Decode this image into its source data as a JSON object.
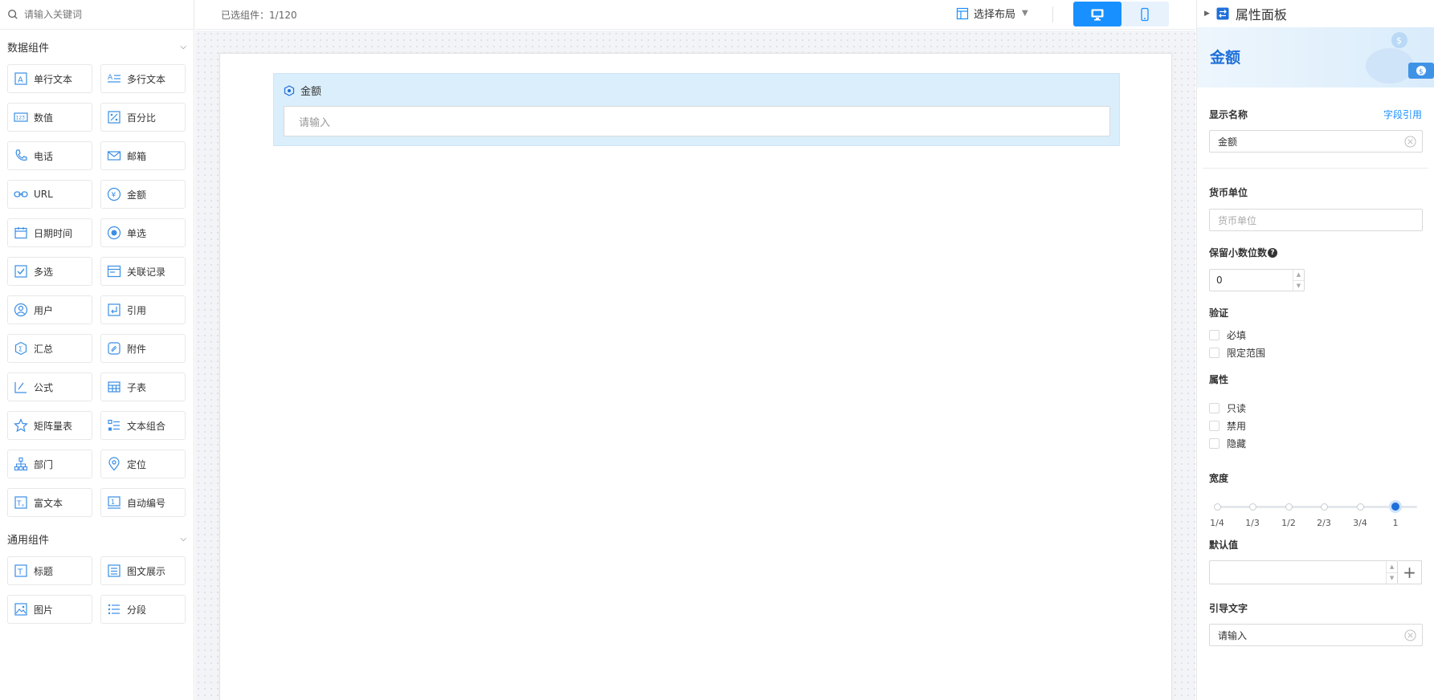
{
  "search": {
    "placeholder": "请输入关键词"
  },
  "data_group": {
    "title": "数据组件",
    "items": [
      {
        "label": "单行文本",
        "icon": "single-line-text-icon"
      },
      {
        "label": "多行文本",
        "icon": "multi-line-text-icon"
      },
      {
        "label": "数值",
        "icon": "number-icon"
      },
      {
        "label": "百分比",
        "icon": "percent-icon"
      },
      {
        "label": "电话",
        "icon": "phone-icon"
      },
      {
        "label": "邮箱",
        "icon": "mail-icon"
      },
      {
        "label": "URL",
        "icon": "link-icon"
      },
      {
        "label": "金额",
        "icon": "currency-icon"
      },
      {
        "label": "日期时间",
        "icon": "calendar-icon"
      },
      {
        "label": "单选",
        "icon": "radio-icon"
      },
      {
        "label": "多选",
        "icon": "checkbox-icon"
      },
      {
        "label": "关联记录",
        "icon": "related-record-icon"
      },
      {
        "label": "用户",
        "icon": "user-icon"
      },
      {
        "label": "引用",
        "icon": "reference-icon"
      },
      {
        "label": "汇总",
        "icon": "summary-icon"
      },
      {
        "label": "附件",
        "icon": "attachment-icon"
      },
      {
        "label": "公式",
        "icon": "formula-icon"
      },
      {
        "label": "子表",
        "icon": "subtable-icon"
      },
      {
        "label": "矩阵量表",
        "icon": "star-icon"
      },
      {
        "label": "文本组合",
        "icon": "text-combo-icon"
      },
      {
        "label": "部门",
        "icon": "department-icon"
      },
      {
        "label": "定位",
        "icon": "location-icon"
      },
      {
        "label": "富文本",
        "icon": "rich-text-icon"
      },
      {
        "label": "自动编号",
        "icon": "auto-number-icon"
      }
    ]
  },
  "general_group": {
    "title": "通用组件",
    "items": [
      {
        "label": "标题",
        "icon": "title-icon"
      },
      {
        "label": "图文展示",
        "icon": "image-text-icon"
      },
      {
        "label": "图片",
        "icon": "image-icon"
      },
      {
        "label": "分段",
        "icon": "section-icon"
      }
    ]
  },
  "topbar": {
    "selected_label": "已选组件：",
    "selected_count": "1/120",
    "layout_label": "选择布局"
  },
  "canvas": {
    "field_label": "金额",
    "field_placeholder": "请输入"
  },
  "panel": {
    "header": "属性面板",
    "banner_title": "金额",
    "display_name_label": "显示名称",
    "field_ref_link": "字段引用",
    "display_name_value": "金额",
    "currency_label": "货币单位",
    "currency_placeholder": "货币单位",
    "decimal_label": "保留小数位数",
    "decimal_value": "0",
    "validation_label": "验证",
    "required_label": "必填",
    "range_label": "限定范围",
    "attributes_label": "属性",
    "readonly_label": "只读",
    "disabled_label": "禁用",
    "hidden_label": "隐藏",
    "width_label": "宽度",
    "width_options": [
      "1/4",
      "1/3",
      "1/2",
      "2/3",
      "3/4",
      "1"
    ],
    "width_selected": "1",
    "default_label": "默认值",
    "guide_label": "引导文字",
    "guide_value": "请输入"
  },
  "colors": {
    "accent": "#1890ff",
    "brand": "#1e6fd9",
    "selection_bg": "#daeefc"
  }
}
